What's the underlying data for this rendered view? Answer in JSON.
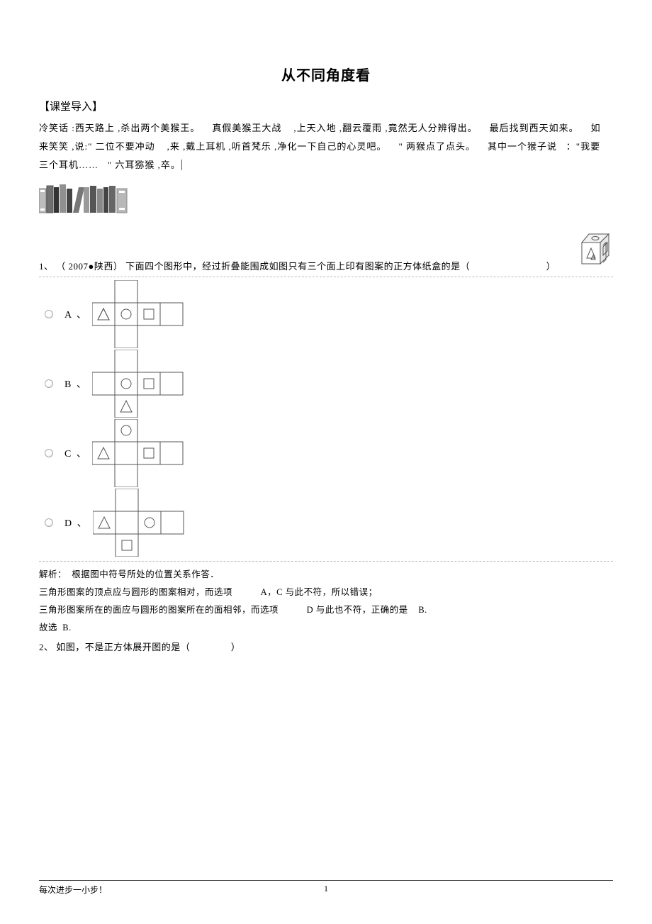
{
  "title": "从不同角度看",
  "section_head": "【课堂导入】",
  "joke": {
    "l1a": "冷笑话 :西天路上 ,杀出两个美猴王。",
    "l1b": "真假美猴王大战",
    "l1c": ",上天入地 ,翻云覆雨 ,竟然无人分辨得出。",
    "l1d": "最后找到西天如来。",
    "l1e": "如",
    "l2a": "来笑笑 ,说:\" 二位不要冲动",
    "l2b": ",来 ,戴上耳机 ,听首梵乐 ,净化一下自己的心灵吧。",
    "l2c": "\" 两猴点了点头。",
    "l2d": "其中一个猴子说",
    "l2e": "：\"我要",
    "l3a": "三个耳机……",
    "l3b": "\" 六耳猕猴 ,卒。"
  },
  "q1": {
    "num": "1、",
    "src": "（ 2007●陕西）",
    "text": "下面四个图形中，经过折叠能围成如图只有三个面上印有图案的正方体纸盒的是（",
    "close": "）"
  },
  "options": {
    "A": "A 、",
    "B": "B 、",
    "C": "C 、",
    "D": "D 、"
  },
  "analysis": {
    "l1a": "解析：",
    "l1b": "根据图中符号所处的位置关系作答．",
    "l2a": "三角形图案的顶点应与圆形的图案相对，而选项",
    "l2b": "A，C",
    "l2c": "与此不符，所以错误；",
    "l3a": "三角形图案所在的面应与圆形的图案所在的面相邻，而选项",
    "l3b": "D",
    "l3c": "与此也不符，正确的是",
    "l3d": "B.",
    "l4a": "故选",
    "l4b": "B."
  },
  "q2": {
    "num": "2、",
    "text": "如图，不是正方体展开图的是（",
    "close": "）"
  },
  "footer": {
    "motto": "每次进步一小步！",
    "page": "1"
  }
}
